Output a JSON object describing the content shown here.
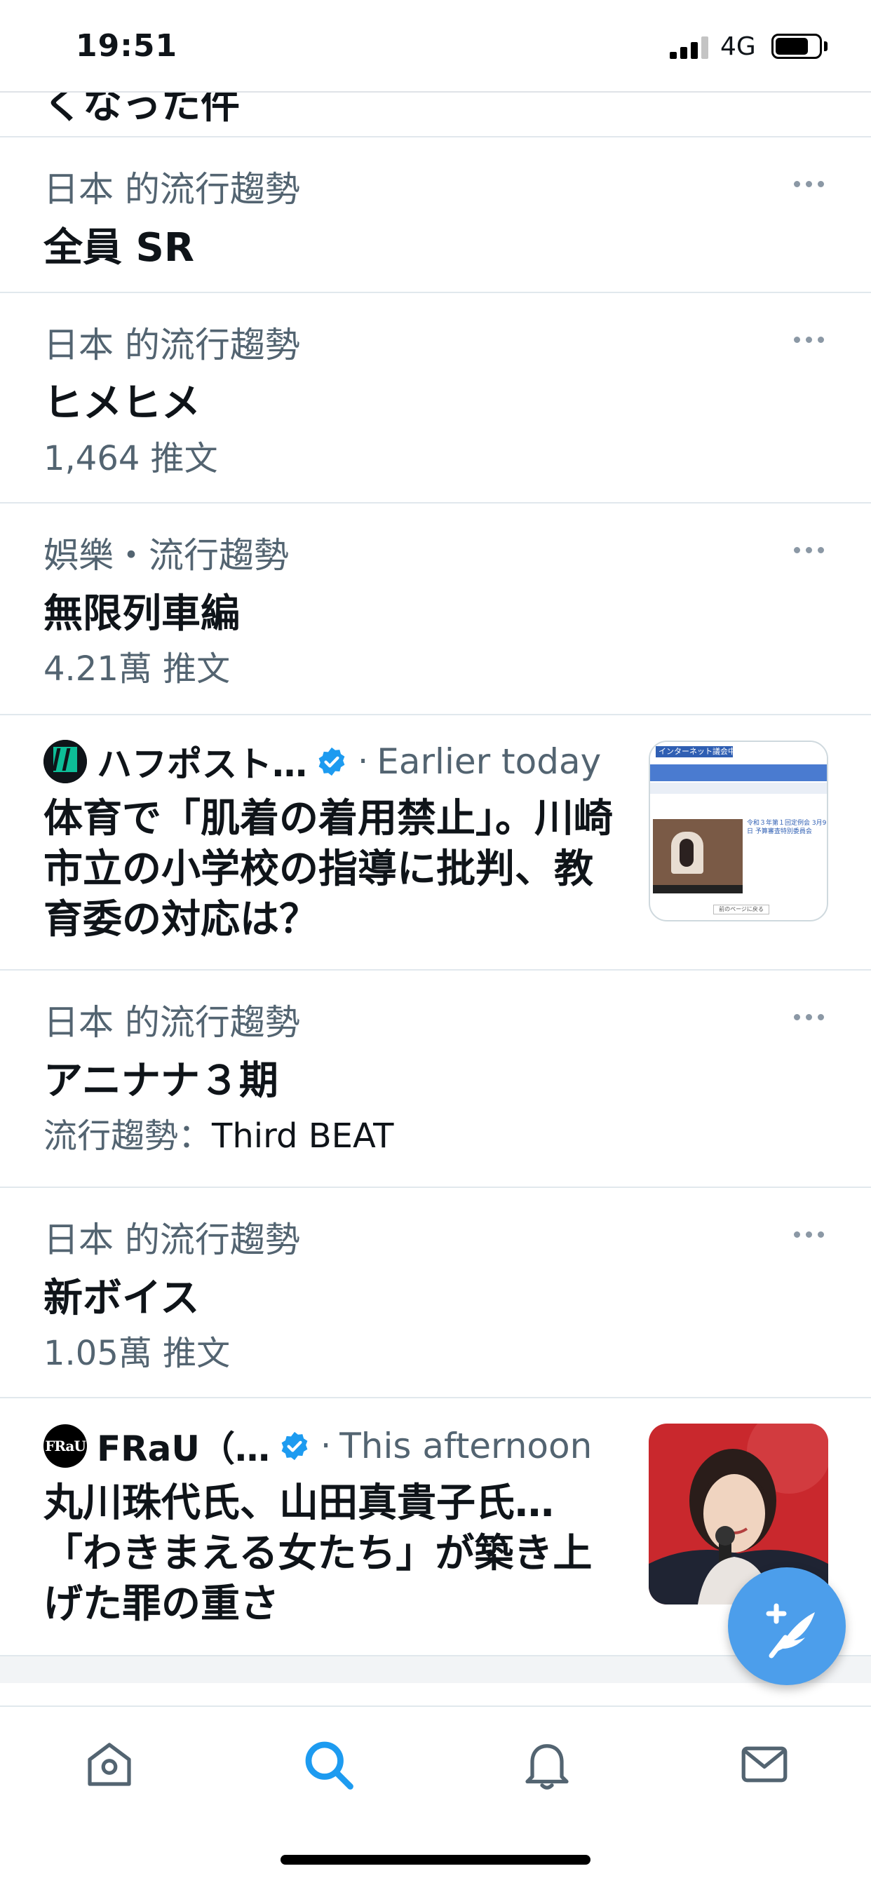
{
  "status_bar": {
    "time": "19:51",
    "network": "4G"
  },
  "partial_row": {
    "text": "くなった件"
  },
  "feed": [
    {
      "kind": "trend",
      "context": "日本 的流行趨勢",
      "topic": "全員 SR"
    },
    {
      "kind": "trend",
      "context": "日本 的流行趨勢",
      "topic": "ヒメヒメ",
      "sub": "1,464 推文"
    },
    {
      "kind": "trend",
      "context": "娯樂・流行趨勢",
      "topic": "無限列車編",
      "sub": "4.21萬 推文"
    },
    {
      "kind": "news",
      "source": "ハフポスト…",
      "separator": "·",
      "time": "Earlier today",
      "headline": "体育で「肌着の着用禁止」。川崎市立の小学校の指導に批判、教育委の対応は？",
      "thumb": {
        "header_text": "インターネット議会中継",
        "caption": "令和３年第１回定例会 3月9日 予算審査特別委員会",
        "footer_text": "前のページに戻る"
      }
    },
    {
      "kind": "trend",
      "context": "日本 的流行趨勢",
      "topic": "アニナナ３期",
      "sub_prefix": "流行趨勢：",
      "sub_tail": "Third BEAT"
    },
    {
      "kind": "trend",
      "context": "日本 的流行趨勢",
      "topic": "新ボイス",
      "sub": "1.05萬 推文"
    },
    {
      "kind": "news",
      "source": "FRaU（…",
      "separator": "·",
      "time": "This afternoon",
      "headline": "丸川珠代氏、山田真貴子氏…「わきまえる女たち」が築き上げた罪の重さ"
    }
  ],
  "avatars": {
    "huffpost": "HUFFPOST",
    "frau": "FRaU"
  },
  "icons": {
    "more": "more-dots-icon",
    "verified": "verified-badge-icon",
    "compose": "compose-tweet-icon",
    "tabs": [
      "home-icon",
      "search-icon",
      "notifications-icon",
      "messages-icon"
    ]
  },
  "colors": {
    "accent": "#1d9bf0",
    "fab": "#4c9eeb",
    "secondary_text": "#536471"
  }
}
